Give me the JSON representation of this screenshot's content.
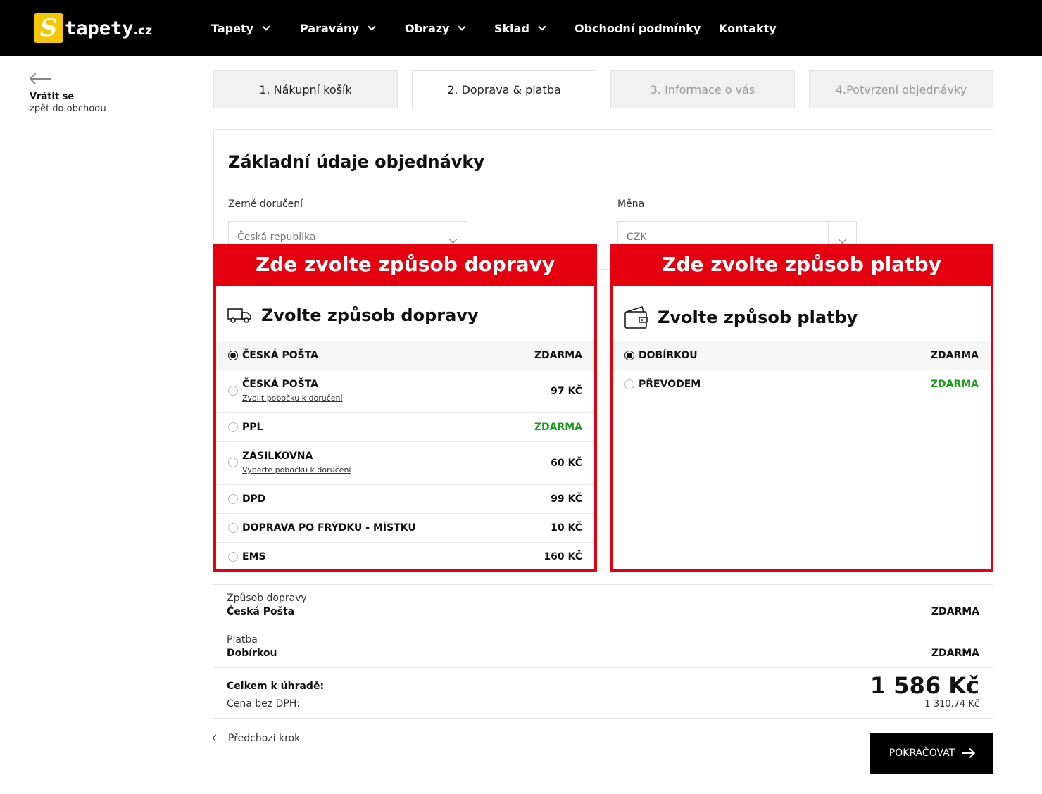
{
  "brand": {
    "logo_letter": "S",
    "logo_text": "tapety",
    "logo_tld": ".cz",
    "accent": "#f6c700"
  },
  "nav": {
    "items": [
      {
        "label": "Tapety",
        "dropdown": true
      },
      {
        "label": "Paravány",
        "dropdown": true
      },
      {
        "label": "Obrazy",
        "dropdown": true
      },
      {
        "label": "Sklad",
        "dropdown": true
      },
      {
        "label": "Obchodní podmínky",
        "dropdown": false
      },
      {
        "label": "Kontakty",
        "dropdown": false
      }
    ]
  },
  "back": {
    "title": "Vrátit se",
    "subtitle": "zpět do obchodu",
    "icon": "arrow-left-icon"
  },
  "steps": [
    {
      "label": "1. Nákupní košík",
      "state": "done"
    },
    {
      "label": "2. Doprava & platba",
      "state": "active"
    },
    {
      "label": "3. Informace o vás",
      "state": "disabled"
    },
    {
      "label": "4.Potvrzení objednávky",
      "state": "disabled"
    }
  ],
  "basics": {
    "title": "Základní údaje objednávky",
    "country_label": "Země doručení",
    "country_value": "Česká republika",
    "currency_label": "Měna",
    "currency_value": "CZK"
  },
  "shipping": {
    "banner": "Zde zvolte způsob dopravy",
    "title": "Zvolte způsob dopravy",
    "icon": "truck-icon",
    "options": [
      {
        "name": "ČESKÁ POŠTA",
        "sub": "",
        "price": "ZDARMA",
        "selected": true,
        "green": false
      },
      {
        "name": "ČESKÁ POŠTA",
        "sub": "Zvolit pobočku k doručení",
        "price": "97 KČ",
        "selected": false,
        "green": false
      },
      {
        "name": "PPL",
        "sub": "",
        "price": "ZDARMA",
        "selected": false,
        "green": true
      },
      {
        "name": "ZÁSILKOVNA",
        "sub": "Vyberte pobočku k doručení",
        "price": "60 KČ",
        "selected": false,
        "green": false
      },
      {
        "name": "DPD",
        "sub": "",
        "price": "99 KČ",
        "selected": false,
        "green": false
      },
      {
        "name": "DOPRAVA PO FRÝDKU - MÍSTKU",
        "sub": "",
        "price": "10 KČ",
        "selected": false,
        "green": false
      },
      {
        "name": "EMS",
        "sub": "",
        "price": "160 KČ",
        "selected": false,
        "green": false
      }
    ]
  },
  "payment": {
    "banner": "Zde zvolte způsob platby",
    "title": "Zvolte způsob platby",
    "icon": "wallet-icon",
    "options": [
      {
        "name": "DOBÍRKOU",
        "price": "ZDARMA",
        "selected": true,
        "green": false
      },
      {
        "name": "PŘEVODEM",
        "price": "ZDARMA",
        "selected": false,
        "green": true
      }
    ]
  },
  "summary": {
    "shipping_label": "Způsob dopravy",
    "shipping_value": "Česká Pošta",
    "shipping_price": "ZDARMA",
    "payment_label": "Platba",
    "payment_value": "Dobírkou",
    "payment_price": "ZDARMA",
    "total_label": "Celkem k úhradě:",
    "net_label": "Cena bez DPH:",
    "total_amount": "1 586 Kč",
    "net_amount": "1 310,74 Kč"
  },
  "actions": {
    "prev_label": "Předchozí krok",
    "next_label": "POKRAČOVAT"
  },
  "colors": {
    "highlight_red": "#e4000f",
    "free_green": "#1a9b1a"
  }
}
